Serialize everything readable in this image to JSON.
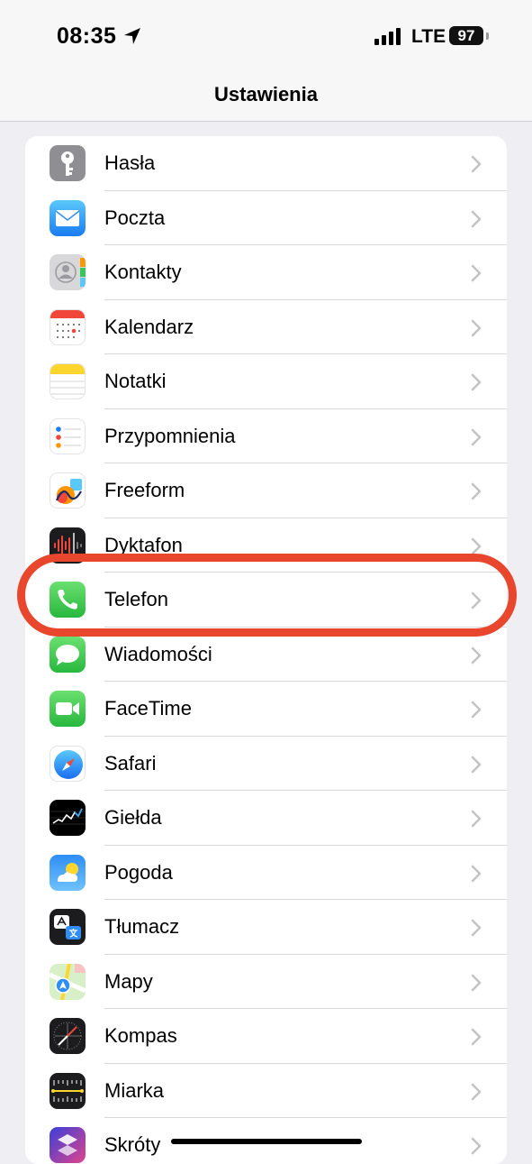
{
  "status_bar": {
    "time": "08:35",
    "network": "LTE",
    "battery": "97"
  },
  "nav": {
    "title": "Ustawienia"
  },
  "rows": [
    {
      "label": "Hasła"
    },
    {
      "label": "Poczta"
    },
    {
      "label": "Kontakty"
    },
    {
      "label": "Kalendarz"
    },
    {
      "label": "Notatki"
    },
    {
      "label": "Przypomnienia"
    },
    {
      "label": "Freeform"
    },
    {
      "label": "Dyktafon"
    },
    {
      "label": "Telefon"
    },
    {
      "label": "Wiadomości"
    },
    {
      "label": "FaceTime"
    },
    {
      "label": "Safari"
    },
    {
      "label": "Giełda"
    },
    {
      "label": "Pogoda"
    },
    {
      "label": "Tłumacz"
    },
    {
      "label": "Mapy"
    },
    {
      "label": "Kompas"
    },
    {
      "label": "Miarka"
    },
    {
      "label": "Skróty"
    }
  ],
  "highlighted_row": "Telefon",
  "colors": {
    "highlight": "#e8462d",
    "chevron": "#c4c4c7"
  }
}
